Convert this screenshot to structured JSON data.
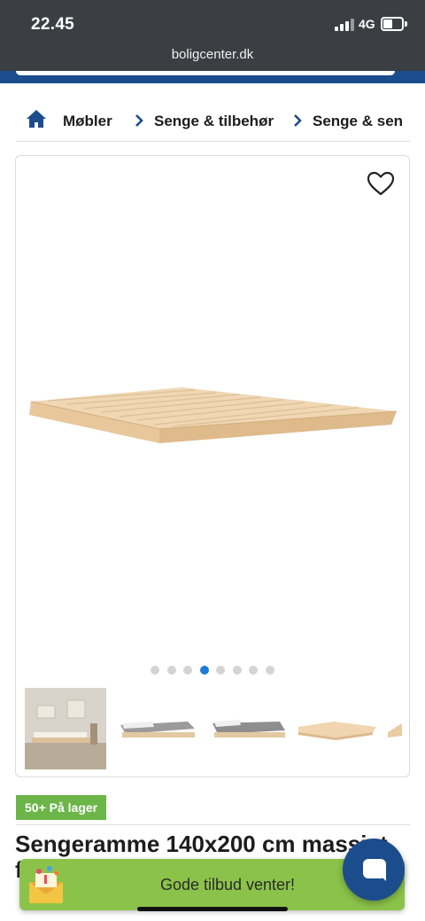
{
  "status_bar": {
    "time": "22.45",
    "network": "4G",
    "url": "boligcenter.dk"
  },
  "breadcrumb": {
    "home_icon": "home-icon",
    "items": [
      {
        "label": "Møbler"
      },
      {
        "label": "Senge & tilbehør"
      },
      {
        "label": "Senge & sen"
      }
    ]
  },
  "product": {
    "favorite_icon": "heart-outline-icon",
    "image_alt": "sengeramme",
    "carousel": {
      "total": 8,
      "active_index": 3
    },
    "thumbnails": [
      {
        "name": "thumb-room"
      },
      {
        "name": "thumb-bed-side"
      },
      {
        "name": "thumb-bed-angle"
      },
      {
        "name": "thumb-frame"
      },
      {
        "name": "thumb-frame-partial"
      }
    ],
    "stock_badge": "50+ På lager",
    "title": "Sengeramme 140x200 cm massivt",
    "title_line2": "f"
  },
  "promo": {
    "text": "Gode tilbud venter!",
    "icon": "gift-envelope-icon"
  },
  "chat": {
    "icon": "chat-bubble-icon"
  },
  "colors": {
    "status_bar_bg": "#3b3e42",
    "brand_blue": "#1b4d8c",
    "stock_green": "#6cb549",
    "promo_green": "#8bc34a",
    "active_dot": "#1e7bd9"
  }
}
